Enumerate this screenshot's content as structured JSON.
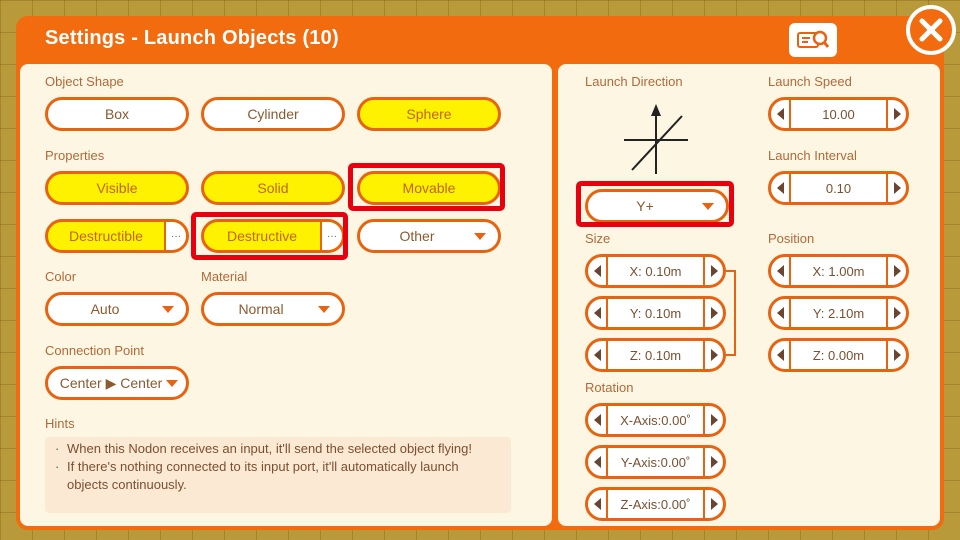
{
  "window": {
    "title": "Settings - Launch Objects (10)"
  },
  "left": {
    "object_shape": {
      "label": "Object Shape",
      "options": [
        "Box",
        "Cylinder",
        "Sphere"
      ],
      "selected": "Sphere"
    },
    "properties": {
      "label": "Properties",
      "visible": "Visible",
      "solid": "Solid",
      "movable": "Movable",
      "destructible": "Destructible",
      "destructive": "Destructive",
      "other": "Other",
      "more": "···"
    },
    "color": {
      "label": "Color",
      "value": "Auto"
    },
    "material": {
      "label": "Material",
      "value": "Normal"
    },
    "connection_point": {
      "label": "Connection Point",
      "value": "Center ▶ Center"
    },
    "hints": {
      "label": "Hints",
      "bullet": "·",
      "items": [
        "When this Nodon receives an input, it'll send the selected object flying!",
        "If there's nothing connected to its input port, it'll automatically launch objects continuously."
      ]
    }
  },
  "right": {
    "launch_direction": {
      "label": "Launch Direction",
      "value": "Y+"
    },
    "launch_speed": {
      "label": "Launch Speed",
      "value": "10.00"
    },
    "launch_interval": {
      "label": "Launch Interval",
      "value": "0.10"
    },
    "size": {
      "label": "Size",
      "x": "X: 0.10m",
      "y": "Y: 0.10m",
      "z": "Z: 0.10m"
    },
    "position": {
      "label": "Position",
      "x": "X: 1.00m",
      "y": "Y: 2.10m",
      "z": "Z: 0.00m"
    },
    "rotation": {
      "label": "Rotation",
      "x": "X-Axis:0.00˚",
      "y": "Y-Axis:0.00˚",
      "z": "Z-Axis:0.00˚"
    }
  },
  "colors": {
    "accent": "#f26b0f",
    "selected": "#fff200",
    "highlight": "#e8000f",
    "panel": "#fdf6e3"
  }
}
